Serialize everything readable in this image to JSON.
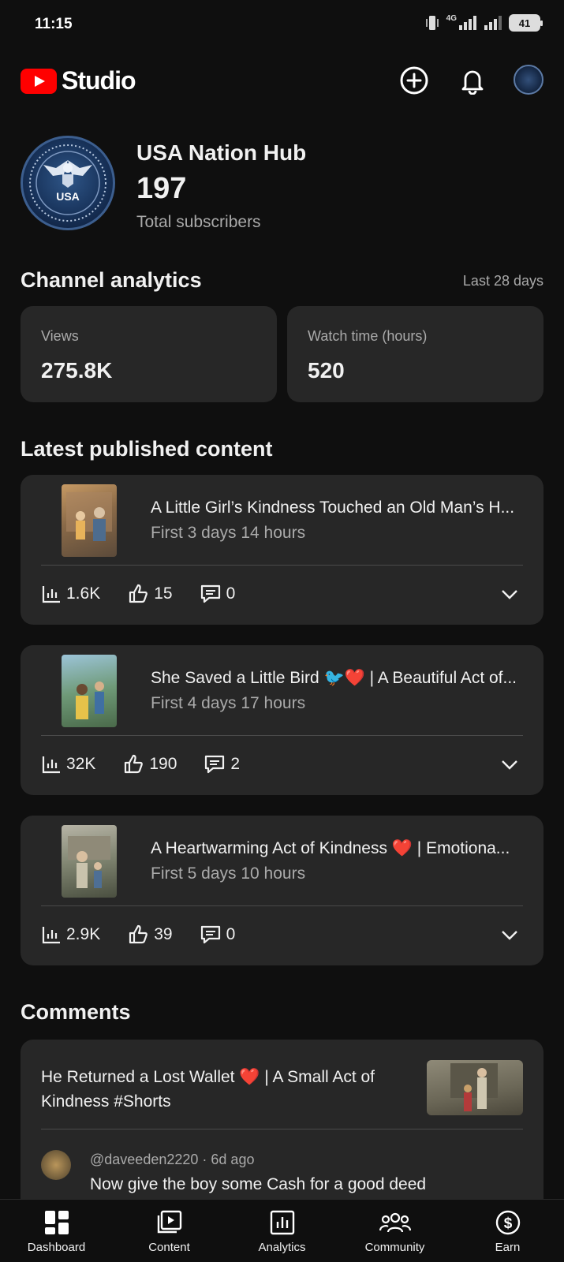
{
  "status_bar": {
    "time": "11:15",
    "network": "4G",
    "battery": "41"
  },
  "app": {
    "brand": "Studio"
  },
  "colors": {
    "accent": "#ff0000",
    "background": "#0f0f0f",
    "card": "#272727",
    "secondary_text": "#aaaaaa",
    "heart": "#e0245e"
  },
  "channel": {
    "name": "USA Nation Hub",
    "subscribers": "197",
    "subscribers_label": "Total subscribers",
    "avatar_text": "USA"
  },
  "analytics": {
    "title": "Channel analytics",
    "period": "Last 28 days",
    "cards": [
      {
        "label": "Views",
        "value": "275.8K"
      },
      {
        "label": "Watch time (hours)",
        "value": "520"
      }
    ]
  },
  "latest": {
    "title": "Latest published content",
    "items": [
      {
        "title": "A Little Girl’s Kindness Touched an Old Man’s H...",
        "subtitle": "First 3 days 14 hours",
        "views": "1.6K",
        "likes": "15",
        "comments": "0"
      },
      {
        "title": "She Saved a Little Bird 🐦❤️ | A Beautiful Act of...",
        "subtitle": "First 4 days 17 hours",
        "views": "32K",
        "likes": "190",
        "comments": "2"
      },
      {
        "title": "A Heartwarming Act of Kindness ❤️ | Emotiona...",
        "subtitle": "First 5 days 10 hours",
        "views": "2.9K",
        "likes": "39",
        "comments": "0"
      }
    ]
  },
  "comments": {
    "title": "Comments",
    "video_title": "He Returned a Lost Wallet ❤️ | A Small Act of Kindness #Shorts",
    "author": "@daveeden2220",
    "time": "6d ago",
    "text": "Now give the boy some Cash for a good deed"
  },
  "nav": [
    {
      "label": "Dashboard",
      "icon": "dashboard-icon"
    },
    {
      "label": "Content",
      "icon": "content-icon"
    },
    {
      "label": "Analytics",
      "icon": "analytics-icon"
    },
    {
      "label": "Community",
      "icon": "community-icon"
    },
    {
      "label": "Earn",
      "icon": "earn-icon"
    }
  ]
}
